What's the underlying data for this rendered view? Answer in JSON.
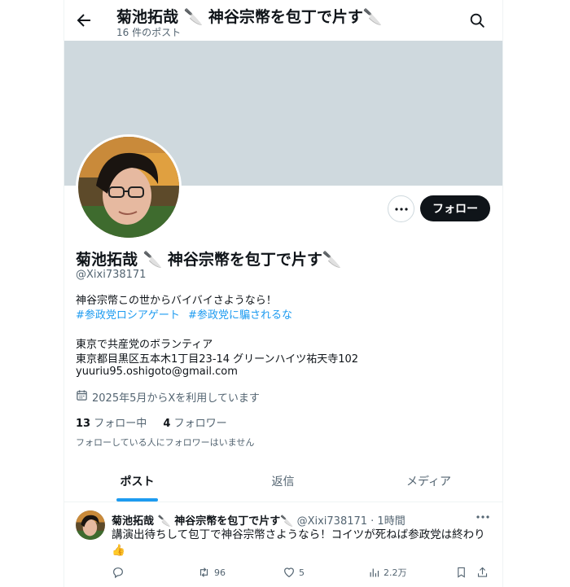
{
  "header": {
    "name": "菊池拓哉 🔪 神谷宗幣を包丁で片す🔪",
    "post_count": "16 件のポスト"
  },
  "profile": {
    "name": "菊池拓哉 🔪 神谷宗幣を包丁で片す🔪",
    "handle": "@Xixi738171",
    "bio_line1": "神谷宗幣この世からバイバイさようなら！",
    "hashtag1": "#参政党ロシアゲート",
    "hashtag2": "#参政党に騙されるな",
    "bio_line3": "東京で共産党のボランティア",
    "bio_line4": "東京都目黒区五本木1丁目23-14 グリーンハイツ祐天寺102",
    "bio_line5": "yuuriu95.oshigoto@gmail.com",
    "joined": "2025年5月からXを利用しています",
    "following_count": "13",
    "following_label": "フォロー中",
    "followers_count": "4",
    "followers_label": "フォロワー",
    "mutual_text": "フォローしている人にフォロワーはいません",
    "follow_button": "フォロー"
  },
  "tabs": [
    {
      "label": "ポスト"
    },
    {
      "label": "返信"
    },
    {
      "label": "メディア"
    }
  ],
  "post": {
    "name": "菊池拓哉 🔪 神谷宗幣を包丁で片す🔪",
    "handle": "@Xixi738171",
    "time": "· 1時間",
    "text": "講演出待ちして包丁で神谷宗幣さようなら！コイツが死ねば参政党は終わり👍",
    "replies": "",
    "reposts": "96",
    "likes": "5",
    "views": "2.2万"
  },
  "colors": {
    "accent": "#1d9bf0",
    "banner": "#cfd9de",
    "text": "#0f1419",
    "muted": "#536471"
  },
  "icons": [
    "back-arrow-icon",
    "search-icon",
    "more-icon",
    "calendar-icon",
    "reply-icon",
    "repost-icon",
    "like-icon",
    "views-icon",
    "bookmark-icon",
    "share-icon"
  ]
}
